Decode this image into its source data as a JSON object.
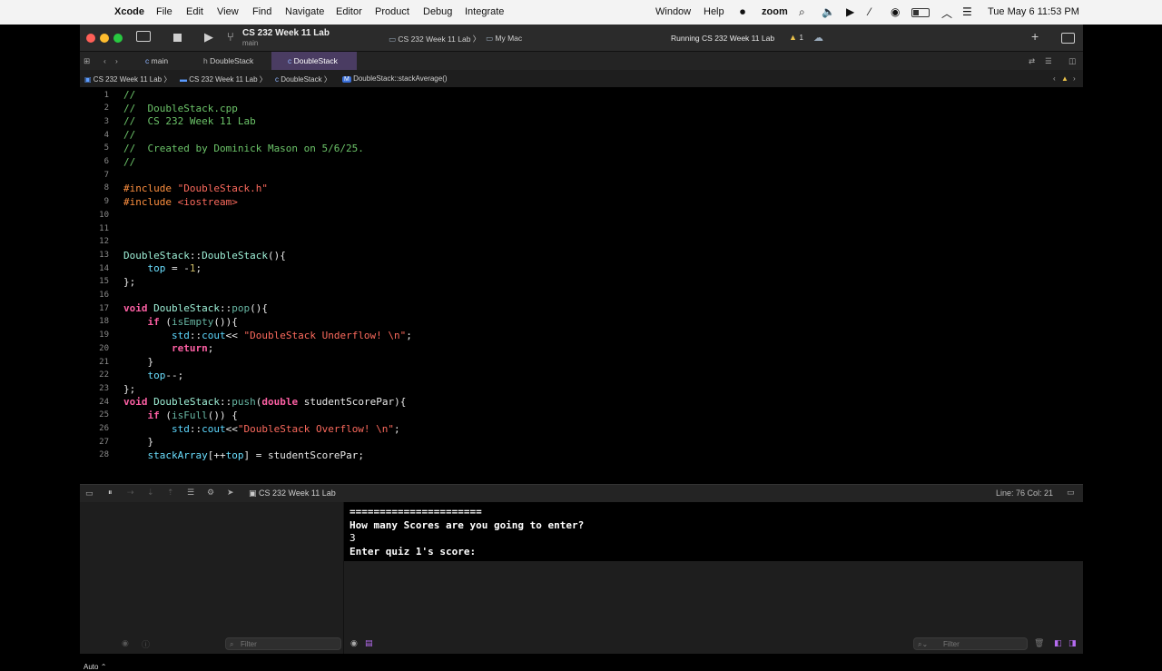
{
  "menubar": {
    "app": "Xcode",
    "items": [
      "File",
      "Edit",
      "View",
      "Find",
      "Navigate",
      "Editor",
      "Product",
      "Debug",
      "Integrate"
    ],
    "right": [
      "Window",
      "Help"
    ],
    "zoom": "zoom",
    "clock": "Tue May 6  11:53 PM"
  },
  "titlebar": {
    "project": "CS 232 Week 11 Lab",
    "branch": "main",
    "scheme": "CS 232 Week 11 Lab",
    "destination": "My Mac",
    "status": "Running CS 232 Week 11 Lab",
    "warnings": "1"
  },
  "tabs": [
    {
      "label": "main",
      "icon": "c-file-icon"
    },
    {
      "label": "DoubleStack",
      "icon": "h-file-icon"
    },
    {
      "label": "DoubleStack",
      "icon": "cpp-file-icon"
    }
  ],
  "breadcrumb": [
    "CS 232 Week 11 Lab",
    "CS 232 Week 11 Lab",
    "DoubleStack",
    "DoubleStack::stackAverage()"
  ],
  "editor": {
    "line_numbers": [
      "1",
      "2",
      "3",
      "4",
      "5",
      "6",
      "7",
      "8",
      "9",
      "10",
      "11",
      "12",
      "13",
      "14",
      "15",
      "16",
      "17",
      "18",
      "19",
      "20",
      "21",
      "22",
      "23",
      "24",
      "25",
      "26",
      "27",
      "28"
    ]
  },
  "debugbar": {
    "target": "CS 232 Week 11 Lab",
    "position": "Line: 76  Col: 21"
  },
  "console": {
    "lines": [
      "======================",
      "How many Scores are you going to enter?",
      "3",
      "Enter quiz 1's score:"
    ]
  },
  "bottom": {
    "auto": "Auto",
    "filter_placeholder": "Filter",
    "filter_placeholder2": "Filter"
  },
  "colors": {
    "comment": "#6cc469",
    "preprocessor": "#fd8f3f",
    "string": "#fc6a5d",
    "keyword": "#fc5fa3",
    "active_tab": "#4a3c62"
  }
}
